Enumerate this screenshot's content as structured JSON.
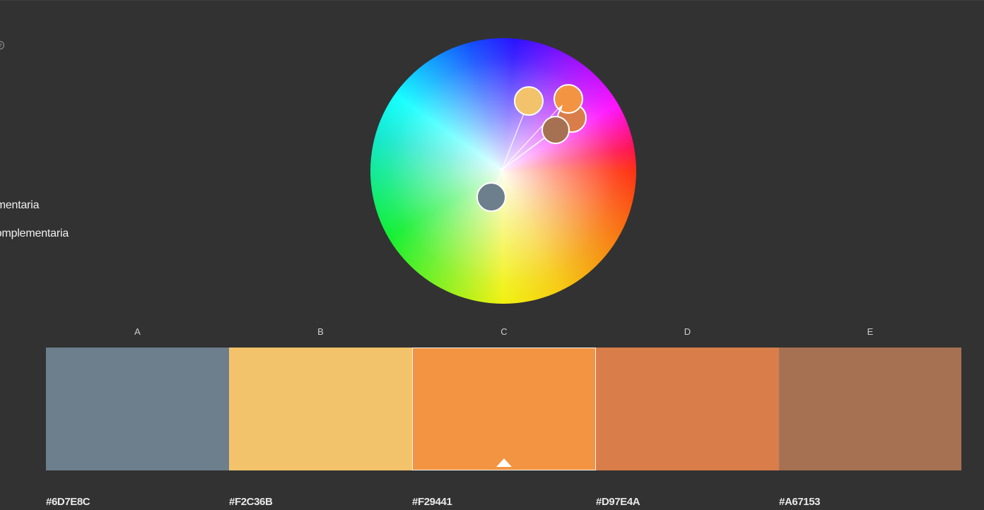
{
  "help_icon_glyph": "?",
  "harmony_rules": [
    {
      "label": "ementaria"
    },
    {
      "label": "complementaria"
    }
  ],
  "color_wheel": {
    "base_handle_color": "#6D7E8C",
    "handles": [
      {
        "id": "A",
        "color": "#6D7E8C"
      },
      {
        "id": "B",
        "color": "#F2C36B"
      },
      {
        "id": "C",
        "color": "#F29441"
      },
      {
        "id": "D",
        "color": "#D97E4A"
      },
      {
        "id": "E",
        "color": "#A67153"
      }
    ]
  },
  "palette": {
    "selected_index": 2,
    "swatches": [
      {
        "letter": "A",
        "hex": "#6D7E8C"
      },
      {
        "letter": "B",
        "hex": "#F2C36B"
      },
      {
        "letter": "C",
        "hex": "#F29441"
      },
      {
        "letter": "D",
        "hex": "#D97E4A"
      },
      {
        "letter": "E",
        "hex": "#A67153"
      }
    ]
  }
}
